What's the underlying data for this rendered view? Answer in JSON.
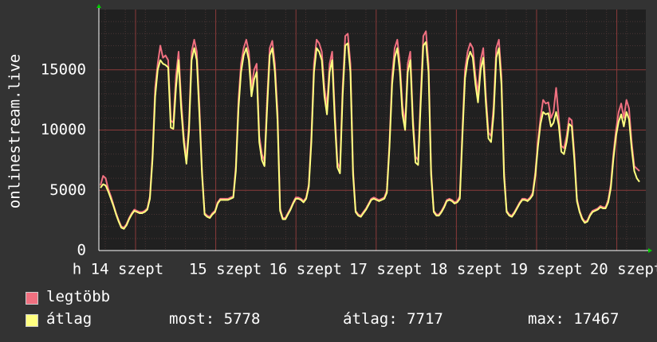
{
  "chart_data": {
    "type": "line",
    "ylabel": "onlinestream.live",
    "ylim": [
      0,
      20000
    ],
    "yticks": [
      0,
      5000,
      10000,
      15000
    ],
    "x_tick_labels": [
      "h 14 szept",
      "15 szept",
      "16 szept",
      "17 szept",
      "18 szept",
      "19 szept",
      "20 szept"
    ],
    "colors": {
      "background": "#333333",
      "plot": "#202020",
      "grid": "#5a3a3a",
      "axis": "#ffffff"
    },
    "series": [
      {
        "name": "legtöbb",
        "color": "#f07080",
        "values": [
          5400,
          6200,
          6000,
          5100,
          4500,
          3800,
          3100,
          2500,
          2000,
          1900,
          2200,
          2700,
          3100,
          3400,
          3300,
          3200,
          3200,
          3300,
          3500,
          4500,
          8000,
          13500,
          15500,
          17000,
          16000,
          16200,
          15800,
          10800,
          10600,
          14500,
          16500,
          12500,
          9500,
          7600,
          10500,
          16500,
          17500,
          16500,
          12000,
          6600,
          3100,
          2900,
          2800,
          3100,
          3300,
          4000,
          4300,
          4300,
          4300,
          4300,
          4400,
          4500,
          7000,
          12500,
          15500,
          16800,
          17500,
          16500,
          13500,
          15000,
          15500,
          9500,
          8000,
          7400,
          12500,
          16800,
          17400,
          15500,
          11500,
          3500,
          2700,
          2700,
          3100,
          3500,
          4000,
          4400,
          4400,
          4300,
          4100,
          4400,
          5500,
          9500,
          15500,
          17500,
          17200,
          16500,
          13500,
          12000,
          15500,
          16500,
          11500,
          7300,
          6800,
          13500,
          17800,
          18000,
          15500,
          6700,
          3300,
          3000,
          2900,
          3200,
          3500,
          3900,
          4300,
          4400,
          4300,
          4200,
          4300,
          4400,
          5000,
          9000,
          14500,
          16800,
          17500,
          15500,
          12000,
          10500,
          15500,
          16500,
          11000,
          7800,
          7500,
          13000,
          17800,
          18200,
          15500,
          6700,
          3300,
          3000,
          3000,
          3300,
          3700,
          4200,
          4300,
          4200,
          4000,
          4100,
          4500,
          10000,
          15000,
          16500,
          17200,
          16800,
          14500,
          13000,
          15800,
          16800,
          13000,
          9800,
          9500,
          12000,
          16800,
          17500,
          14500,
          6500,
          3300,
          3000,
          2900,
          3200,
          3600,
          4000,
          4300,
          4300,
          4200,
          4400,
          4800,
          6500,
          9000,
          11000,
          12500,
          12200,
          12300,
          11000,
          11500,
          13500,
          11000,
          8700,
          8500,
          9500,
          11000,
          10800,
          8000,
          4300,
          3300,
          2700,
          2400,
          2500,
          3000,
          3300,
          3400,
          3500,
          3700,
          3600,
          3600,
          4200,
          5500,
          8000,
          10000,
          11500,
          12200,
          11000,
          12500,
          11800,
          9000,
          7000,
          6800,
          6600
        ]
      },
      {
        "name": "átlag",
        "color": "#ffff80",
        "values": [
          5200,
          5500,
          5400,
          4900,
          4300,
          3700,
          3000,
          2400,
          1900,
          1800,
          2100,
          2600,
          3000,
          3300,
          3200,
          3100,
          3100,
          3200,
          3400,
          4300,
          7600,
          12800,
          15000,
          15800,
          15500,
          15400,
          15200,
          10200,
          10100,
          13500,
          15800,
          11800,
          9000,
          7200,
          9900,
          15800,
          16800,
          15800,
          11300,
          6300,
          3000,
          2800,
          2700,
          3000,
          3200,
          3900,
          4200,
          4200,
          4200,
          4200,
          4300,
          4400,
          6600,
          11800,
          14800,
          16200,
          16800,
          15800,
          12800,
          14200,
          14800,
          9000,
          7500,
          7000,
          11800,
          16200,
          16800,
          14800,
          10800,
          3300,
          2600,
          2600,
          3000,
          3400,
          3900,
          4300,
          4300,
          4200,
          4000,
          4300,
          5300,
          9000,
          14800,
          16800,
          16500,
          15800,
          12800,
          11300,
          14800,
          15800,
          10800,
          6900,
          6400,
          12800,
          17000,
          17200,
          14800,
          6300,
          3200,
          2900,
          2800,
          3100,
          3400,
          3800,
          4200,
          4300,
          4200,
          4100,
          4200,
          4300,
          4800,
          8600,
          13800,
          16000,
          16800,
          14800,
          11300,
          10000,
          14800,
          15800,
          10400,
          7300,
          7100,
          12300,
          17000,
          17300,
          14800,
          6300,
          3200,
          2900,
          2900,
          3200,
          3600,
          4100,
          4200,
          4100,
          3900,
          4000,
          4300,
          9400,
          14300,
          15800,
          16500,
          16000,
          13800,
          12300,
          15000,
          16000,
          12300,
          9300,
          9000,
          11300,
          16000,
          16800,
          13800,
          6100,
          3200,
          2900,
          2800,
          3100,
          3500,
          3900,
          4200,
          4200,
          4100,
          4300,
          4600,
          6200,
          8600,
          10500,
          11500,
          11300,
          11400,
          10300,
          10600,
          11500,
          10400,
          8200,
          8000,
          9000,
          10500,
          10300,
          7500,
          4100,
          3200,
          2600,
          2300,
          2400,
          2900,
          3200,
          3300,
          3400,
          3600,
          3500,
          3500,
          4000,
          5200,
          7600,
          9500,
          10700,
          11300,
          10300,
          11500,
          10900,
          8500,
          6600,
          6000,
          5700
        ]
      }
    ]
  },
  "legend": {
    "items": [
      {
        "label": "legtöbb",
        "color": "#f07080"
      },
      {
        "label": "átlag",
        "color": "#ffff80"
      }
    ],
    "stats": {
      "most": "most: 5778",
      "avg": "átlag: 7717",
      "max": "max: 17467"
    }
  }
}
